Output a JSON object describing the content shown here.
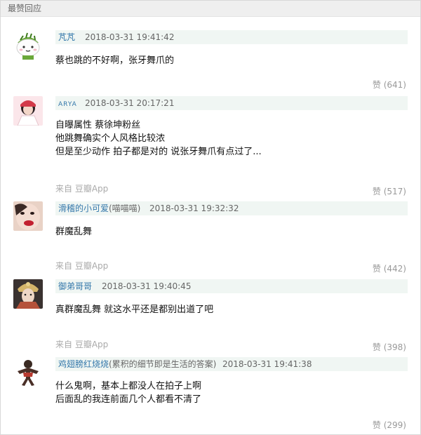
{
  "section": {
    "title": "最赞回应"
  },
  "comments": [
    {
      "author": "芃芃",
      "time": "2018-03-31 19:41:42",
      "lines": [
        "蔡也跳的不好啊，张牙舞爪的"
      ],
      "like_label": "赞",
      "like_count": "(641)"
    },
    {
      "author": "ARYA",
      "time": "2018-03-31 20:17:21",
      "lines": [
        "自曝属性 蔡徐坤粉丝",
        "他跳舞确实个人风格比较浓",
        "但是至少动作 拍子都是对的 说张牙舞爪有点过了..."
      ],
      "source": "来自 豆瓣App",
      "like_label": "赞",
      "like_count": "(517)"
    },
    {
      "author": "滑稽的小可爱",
      "signature": "(喵喵喵)",
      "time": "2018-03-31 19:32:32",
      "lines": [
        "群魔乱舞"
      ],
      "source": "来自 豆瓣App",
      "like_label": "赞",
      "like_count": "(442)"
    },
    {
      "author": "御弟哥哥",
      "time": "2018-03-31 19:40:45",
      "lines": [
        "真群魔乱舞 就这水平还是都别出道了吧"
      ],
      "source": "来自 豆瓣App",
      "like_label": "赞",
      "like_count": "(398)"
    },
    {
      "author": "鸡翅膀红烧烧",
      "signature": "(累积的细节即是生活的答案)",
      "time": "2018-03-31 19:41:38",
      "lines": [
        "什么鬼啊，基本上都没人在拍子上啊",
        "后面乱的我连前面几个人都看不清了"
      ],
      "like_label": "赞",
      "like_count": "(299)"
    }
  ]
}
